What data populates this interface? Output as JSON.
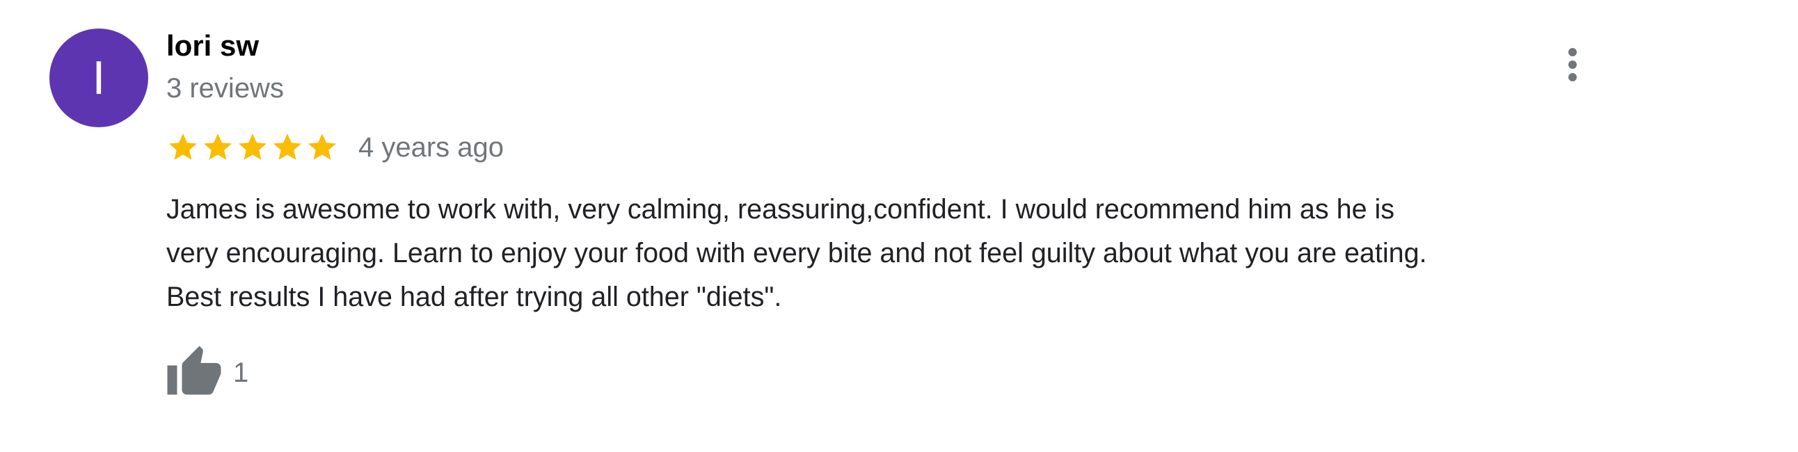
{
  "reviewer": {
    "avatar_initial": "I",
    "avatar_color": "#5E35B1",
    "name": "lori sw",
    "review_count": "3 reviews"
  },
  "review": {
    "rating": 5,
    "rating_max": 5,
    "star_color": "#FBBC04",
    "time": "4 years ago",
    "text": "James is awesome to work with, very calming, reassuring,confident. I would recommend him as he is\nvery encouraging. Learn to enjoy your food with every bite and not feel guilty about what you are eating.\nBest results I have had after trying all other \"diets\"."
  },
  "actions": {
    "like_count": "1",
    "like_icon": "thumbs-up-icon",
    "more_icon": "more-vertical-icon",
    "icon_color": "#70757a"
  }
}
